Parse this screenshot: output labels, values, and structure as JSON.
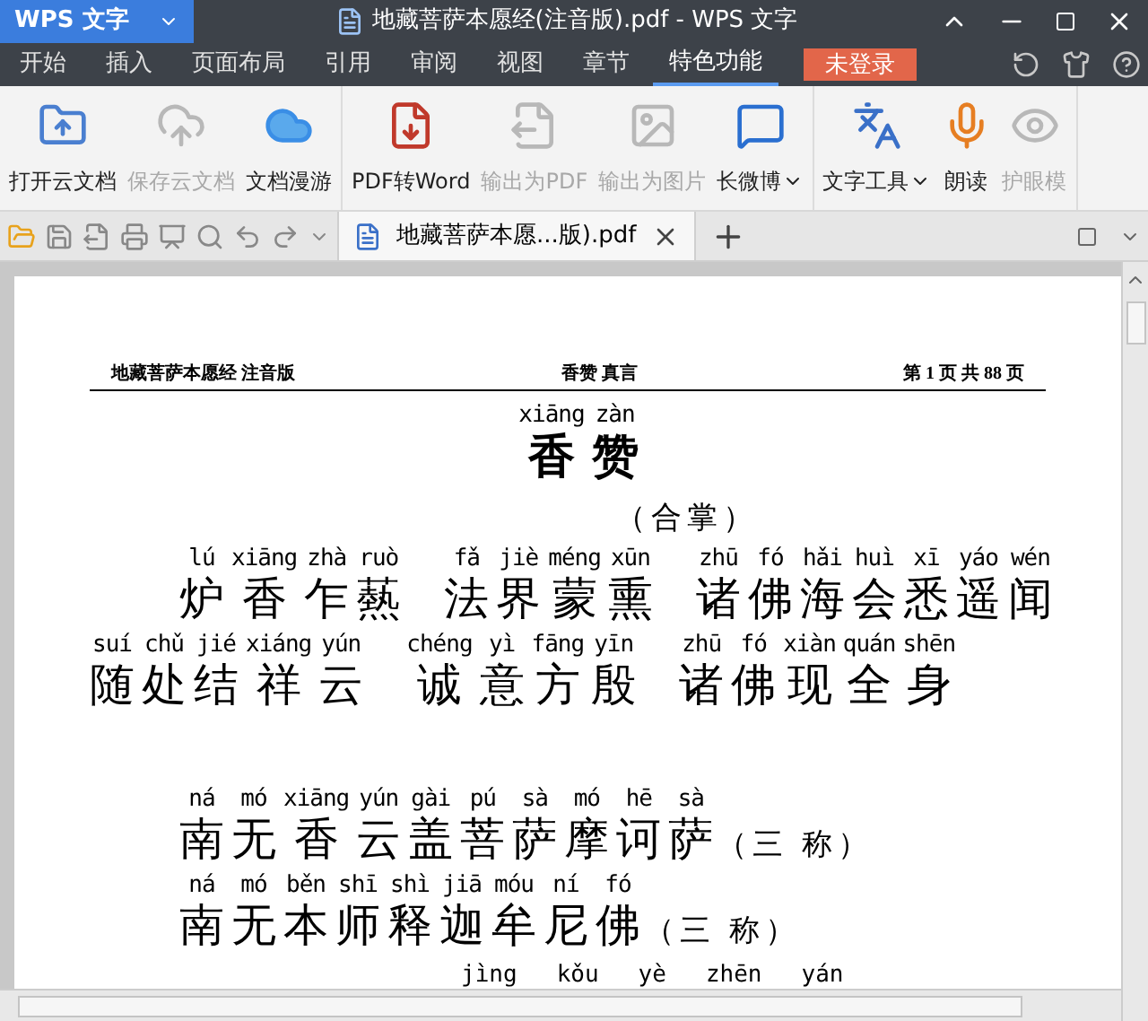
{
  "window": {
    "app_name": "WPS 文字",
    "title": "地藏菩萨本愿经(注音版).pdf - WPS 文字"
  },
  "menu_tabs": [
    {
      "label": "开始",
      "selected": false
    },
    {
      "label": "插入",
      "selected": false
    },
    {
      "label": "页面布局",
      "selected": false
    },
    {
      "label": "引用",
      "selected": false
    },
    {
      "label": "审阅",
      "selected": false
    },
    {
      "label": "视图",
      "selected": false
    },
    {
      "label": "章节",
      "selected": false
    },
    {
      "label": "特色功能",
      "selected": true
    }
  ],
  "login_button": "未登录",
  "ribbon_groups": [
    [
      {
        "kind": "cloud-folder",
        "label": "打开云文档",
        "disabled": false,
        "dropdown": false
      },
      {
        "kind": "save-cloud",
        "label": "保存云文档",
        "disabled": true,
        "dropdown": false
      },
      {
        "kind": "cloud",
        "label": "文档漫游",
        "disabled": false,
        "dropdown": false
      }
    ],
    [
      {
        "kind": "pdf-word",
        "label": "PDF转Word",
        "disabled": false,
        "dropdown": false
      },
      {
        "kind": "export-pdf",
        "label": "输出为PDF",
        "disabled": true,
        "dropdown": false
      },
      {
        "kind": "export-image",
        "label": "输出为图片",
        "disabled": true,
        "dropdown": false
      },
      {
        "kind": "weibo",
        "label": "长微博",
        "disabled": false,
        "dropdown": true
      }
    ],
    [
      {
        "kind": "text-tools",
        "label": "文字工具",
        "disabled": false,
        "dropdown": true
      },
      {
        "kind": "read-aloud",
        "label": "朗读",
        "disabled": false,
        "dropdown": false
      },
      {
        "kind": "eye-care",
        "label": "护眼模",
        "disabled": true,
        "dropdown": false
      }
    ]
  ],
  "document_tab": {
    "label": "地藏菩萨本愿...版).pdf"
  },
  "page": {
    "header": {
      "left": "地藏菩萨本愿经 注音版",
      "center": "香赞 真言",
      "right": "第 1 页 共 88 页"
    },
    "title": [
      {
        "py": "xiāng",
        "ch": "香"
      },
      {
        "py": "zàn",
        "ch": "赞"
      }
    ],
    "note": "（合掌）",
    "lines": [
      {
        "phrases": [
          [
            {
              "py": "lú",
              "ch": "炉"
            },
            {
              "py": "xiāng",
              "ch": "香"
            },
            {
              "py": "zhà",
              "ch": "乍"
            },
            {
              "py": "ruò",
              "ch": "爇"
            }
          ],
          [
            {
              "py": "fǎ",
              "ch": "法"
            },
            {
              "py": "jiè",
              "ch": "界"
            },
            {
              "py": "méng",
              "ch": "蒙"
            },
            {
              "py": "xūn",
              "ch": "熏"
            }
          ],
          [
            {
              "py": "zhū",
              "ch": "诸"
            },
            {
              "py": "fó",
              "ch": "佛"
            },
            {
              "py": "hǎi",
              "ch": "海"
            },
            {
              "py": "huì",
              "ch": "会"
            },
            {
              "py": "xī",
              "ch": "悉"
            },
            {
              "py": "yáo",
              "ch": "遥"
            },
            {
              "py": "wén",
              "ch": "闻"
            }
          ]
        ]
      },
      {
        "phrases": [
          [
            {
              "py": "suí",
              "ch": "随"
            },
            {
              "py": "chǔ",
              "ch": "处"
            },
            {
              "py": "jié",
              "ch": "结"
            },
            {
              "py": "xiáng",
              "ch": "祥"
            },
            {
              "py": "yún",
              "ch": "云"
            }
          ],
          [
            {
              "py": "chéng",
              "ch": "诚"
            },
            {
              "py": "yì",
              "ch": "意"
            },
            {
              "py": "fāng",
              "ch": "方"
            },
            {
              "py": "yīn",
              "ch": "殷"
            }
          ],
          [
            {
              "py": "zhū",
              "ch": "诸"
            },
            {
              "py": "fó",
              "ch": "佛"
            },
            {
              "py": "xiàn",
              "ch": "现"
            },
            {
              "py": "quán",
              "ch": "全"
            },
            {
              "py": "shēn",
              "ch": "身"
            }
          ]
        ]
      },
      {
        "suffix": "（三 称）",
        "phrases": [
          [
            {
              "py": "ná",
              "ch": "南"
            },
            {
              "py": "mó",
              "ch": "无"
            },
            {
              "py": "xiāng",
              "ch": "香"
            },
            {
              "py": "yún",
              "ch": "云"
            },
            {
              "py": "gài",
              "ch": "盖"
            },
            {
              "py": "pú",
              "ch": "菩"
            },
            {
              "py": "sà",
              "ch": "萨"
            },
            {
              "py": "mó",
              "ch": "摩"
            },
            {
              "py": "hē",
              "ch": "诃"
            },
            {
              "py": "sà",
              "ch": "萨"
            }
          ]
        ]
      },
      {
        "suffix": "（三 称）",
        "phrases": [
          [
            {
              "py": "ná",
              "ch": "南"
            },
            {
              "py": "mó",
              "ch": "无"
            },
            {
              "py": "běn",
              "ch": "本"
            },
            {
              "py": "shī",
              "ch": "师"
            },
            {
              "py": "shì",
              "ch": "释"
            },
            {
              "py": "jiā",
              "ch": "迦"
            },
            {
              "py": "móu",
              "ch": "牟"
            },
            {
              "py": "ní",
              "ch": "尼"
            },
            {
              "py": "fó",
              "ch": "佛"
            }
          ]
        ]
      }
    ],
    "partial_pinyin": [
      "jìng",
      "kǒu",
      "yè",
      "zhēn",
      "yán"
    ]
  }
}
